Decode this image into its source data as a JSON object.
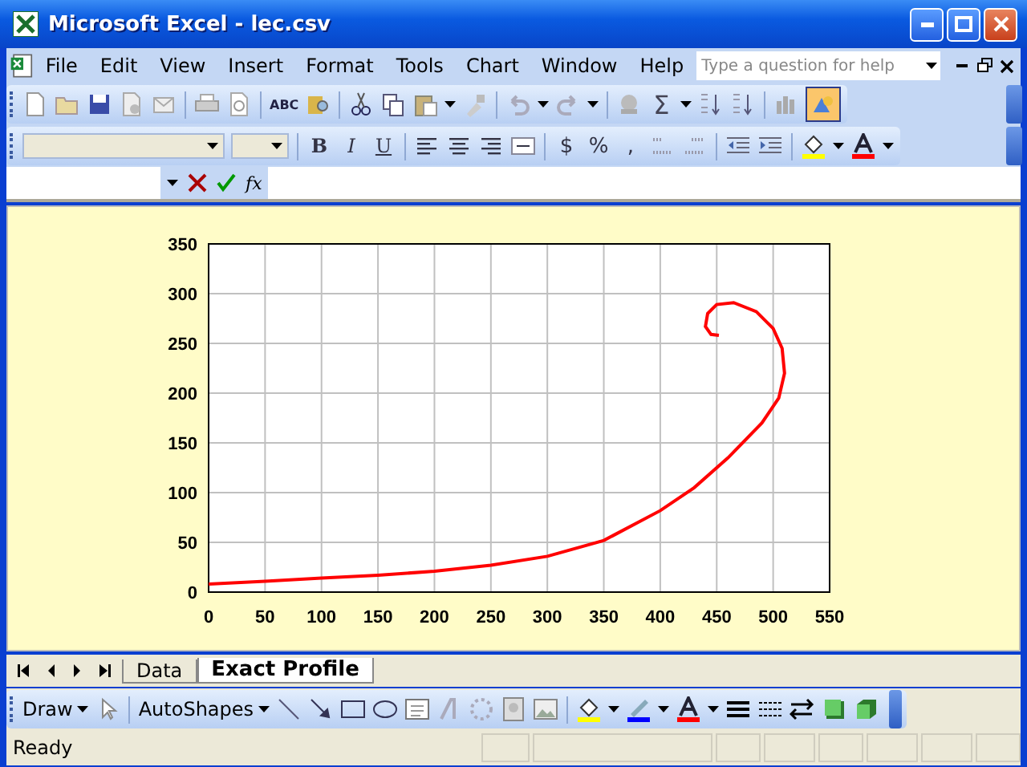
{
  "window": {
    "title": "Microsoft Excel - lec.csv"
  },
  "menu": [
    "File",
    "Edit",
    "View",
    "Insert",
    "Format",
    "Tools",
    "Chart",
    "Window",
    "Help"
  ],
  "help_box": {
    "placeholder": "Type a question for help"
  },
  "formatting_toolbar": {
    "bold": "B",
    "italic": "I",
    "underline": "U",
    "currency": "$",
    "percent": "%",
    "comma": ","
  },
  "standard_toolbar": {
    "autosum": "Σ",
    "spelling": "ABC"
  },
  "formula_bar": {
    "function_label": "fx"
  },
  "chart": {
    "chart_data": {
      "type": "line",
      "x": [
        0,
        50,
        100,
        150,
        200,
        250,
        300,
        350,
        400,
        430,
        460,
        490,
        505,
        510,
        508,
        500,
        485,
        465,
        450,
        442,
        440,
        445,
        452
      ],
      "series": [
        {
          "color": "#ff0000",
          "values": [
            8,
            11,
            14,
            17,
            21,
            27,
            36,
            52,
            82,
            105,
            135,
            170,
            195,
            220,
            245,
            265,
            282,
            291,
            289,
            280,
            267,
            259,
            258
          ]
        }
      ],
      "xlim": [
        0,
        550
      ],
      "ylim": [
        0,
        350
      ],
      "xticks": [
        0,
        50,
        100,
        150,
        200,
        250,
        300,
        350,
        400,
        450,
        500,
        550
      ],
      "yticks": [
        0,
        50,
        100,
        150,
        200,
        250,
        300,
        350
      ],
      "grid": true
    }
  },
  "sheet_tabs": [
    {
      "label": "Data",
      "selected": false
    },
    {
      "label": "Exact Profile",
      "selected": true
    }
  ],
  "drawing_toolbar": {
    "draw": "Draw",
    "autoshapes": "AutoShapes"
  },
  "status_bar": {
    "text": "Ready"
  }
}
